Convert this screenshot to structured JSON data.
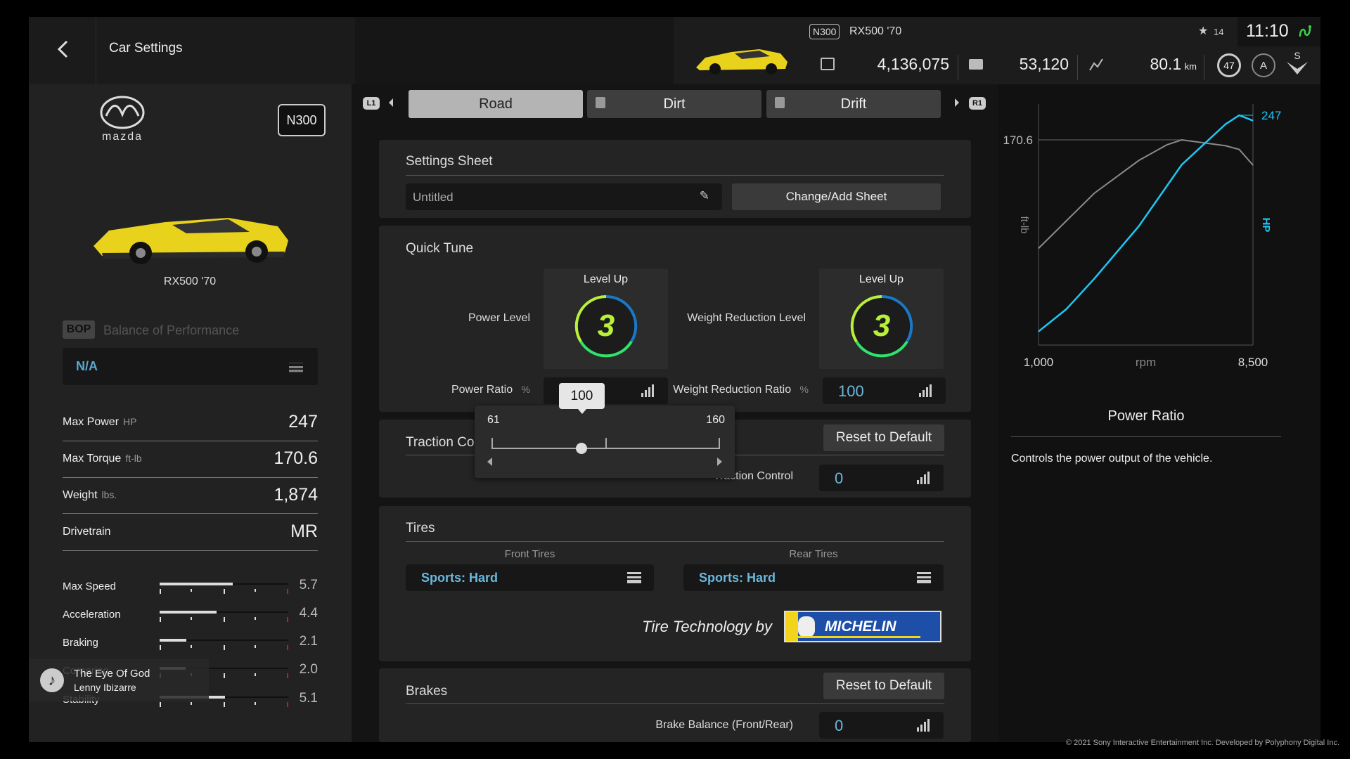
{
  "header": {
    "title": "Car Settings",
    "car_class": "N300",
    "car_name": "RX500 '70",
    "credits": "4,136,075",
    "mileage_points": "53,120",
    "distance": "80.1",
    "distance_unit": "km",
    "trophy_count": "14",
    "clock": "11:10",
    "driver_level": "47",
    "license": "A",
    "rank": "S"
  },
  "tabs": {
    "left_button": "L1",
    "right_button": "R1",
    "items": [
      {
        "label": "Road",
        "active": true,
        "locked": false
      },
      {
        "label": "Dirt",
        "active": false,
        "locked": true
      },
      {
        "label": "Drift",
        "active": false,
        "locked": true
      }
    ]
  },
  "sidebar": {
    "brand": "mazda",
    "class_badge": "N300",
    "car_name": "RX500 '70",
    "bop_badge": "BOP",
    "bop_label": "Balance of Performance",
    "bop_value": "N/A",
    "specs": [
      {
        "label": "Max Power",
        "unit": "HP",
        "value": "247"
      },
      {
        "label": "Max Torque",
        "unit": "ft-lb",
        "value": "170.6"
      },
      {
        "label": "Weight",
        "unit": "lbs.",
        "value": "1,874"
      },
      {
        "label": "Drivetrain",
        "unit": "",
        "value": "MR"
      }
    ],
    "performance_scale_max": 10,
    "performance": [
      {
        "label": "Max Speed",
        "value": "5.7"
      },
      {
        "label": "Acceleration",
        "value": "4.4"
      },
      {
        "label": "Braking",
        "value": "2.1"
      },
      {
        "label": "Cornering",
        "value": "2.0"
      },
      {
        "label": "Stability",
        "value": "5.1"
      }
    ],
    "now_playing": {
      "title": "The Eye Of God",
      "artist": "Lenny Ibizarre"
    }
  },
  "settings_sheet": {
    "title": "Settings Sheet",
    "sheet_name": "Untitled",
    "change_button": "Change/Add Sheet"
  },
  "quick_tune": {
    "title": "Quick Tune",
    "power_level_label": "Power Level",
    "power_level_caption": "Level Up",
    "power_level": "3",
    "weight_level_label": "Weight Reduction Level",
    "weight_level_caption": "Level Up",
    "weight_level": "3",
    "power_ratio_label": "Power Ratio",
    "power_ratio_unit": "%",
    "power_ratio": "100",
    "weight_ratio_label": "Weight Reduction Ratio",
    "weight_ratio_unit": "%",
    "weight_ratio": "100"
  },
  "slider_popup": {
    "value": "100",
    "min": "61",
    "max": "160"
  },
  "traction": {
    "title": "Traction Control",
    "reset_button": "Reset to Default",
    "field_label": "Traction Control",
    "value": "0"
  },
  "tires": {
    "title": "Tires",
    "front_label": "Front Tires",
    "front_value": "Sports: Hard",
    "rear_label": "Rear Tires",
    "rear_value": "Sports: Hard",
    "tech_by": "Tire Technology by",
    "sponsor_logo": "MICHELIN"
  },
  "brakes": {
    "title": "Brakes",
    "reset_button": "Reset to Default",
    "balance_label": "Brake Balance (Front/Rear)",
    "balance_value": "0"
  },
  "info": {
    "title": "Power Ratio",
    "description": "Controls the power output of the vehicle."
  },
  "chart_data": {
    "type": "line",
    "xlabel": "rpm",
    "x_ticks": [
      "1,000",
      "8,500"
    ],
    "xlim": [
      1000,
      8500
    ],
    "y_left_label": "ft-lb",
    "y_left_tick": "170.6",
    "y_right_label": "HP",
    "y_right_tick": "247",
    "grid": false,
    "colors": {
      "torque": "#8a8a8a",
      "power": "#1ec8f5"
    },
    "series": [
      {
        "axis": "left",
        "x": [
          1000,
          2950,
          4510,
          5490,
          6010,
          7540,
          8020,
          8500
        ],
        "values": [
          80.4,
          126.2,
          153.5,
          166.5,
          170.6,
          165.7,
          162.6,
          149.6
        ]
      },
      {
        "axis": "right",
        "x": [
          1000,
          1970,
          2950,
          4510,
          6010,
          7540,
          8020,
          8500
        ],
        "values": [
          14.6,
          38.5,
          71.3,
          127.9,
          193.9,
          237.4,
          247,
          241.2
        ]
      }
    ]
  },
  "footer": {
    "copyright": "© 2021 Sony Interactive Entertainment Inc. Developed by Polyphony Digital Inc."
  }
}
